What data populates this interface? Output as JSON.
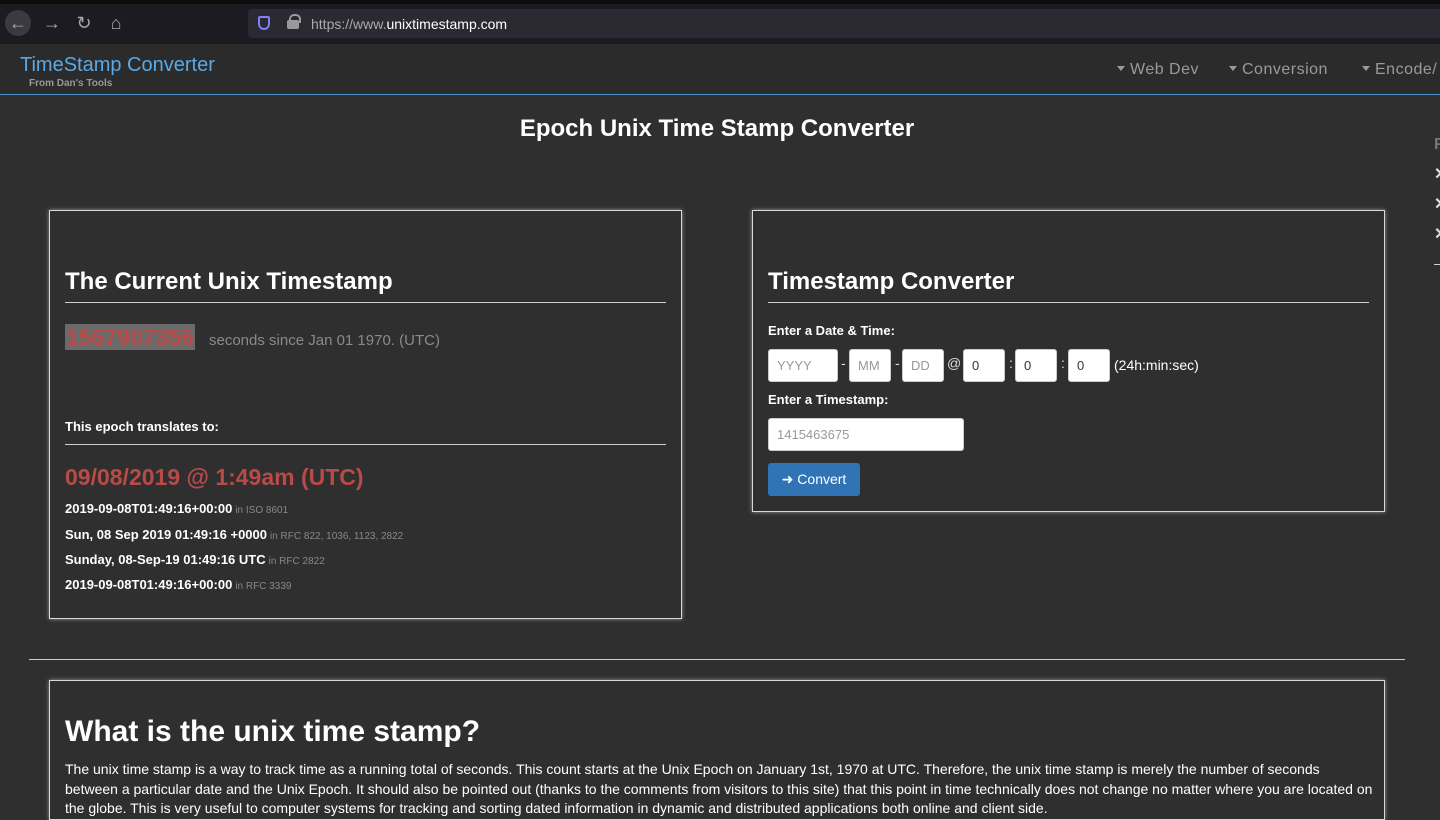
{
  "browser": {
    "url_prefix": "https://www.",
    "url_domain": "unixtimestamp",
    "url_suffix": ".com"
  },
  "header": {
    "brand": "TimeStamp Converter",
    "brand_sub": "From Dan's Tools",
    "nav": [
      "Web Dev",
      "Conversion",
      "Encode/"
    ]
  },
  "page_title": "Epoch Unix Time Stamp Converter",
  "current": {
    "heading": "The Current Unix Timestamp",
    "timestamp": "1567907356",
    "since_text": "seconds since Jan 01 1970. (UTC)",
    "translates_label": "This epoch translates to:",
    "date_display": "09/08/2019 @ 1:49am (UTC)",
    "formats": [
      {
        "value": "2019-09-08T01:49:16+00:00",
        "note": "in ISO 8601"
      },
      {
        "value": "Sun, 08 Sep 2019 01:49:16 +0000",
        "note": "in RFC 822, 1036, 1123, 2822"
      },
      {
        "value": "Sunday, 08-Sep-19 01:49:16 UTC",
        "note": "in RFC 2822"
      },
      {
        "value": "2019-09-08T01:49:16+00:00",
        "note": "in RFC 3339"
      }
    ]
  },
  "converter": {
    "heading": "Timestamp Converter",
    "date_label": "Enter a Date & Time:",
    "year_placeholder": "YYYY",
    "month_placeholder": "MM",
    "day_placeholder": "DD",
    "at": "@",
    "hour": "0",
    "min": "0",
    "sec": "0",
    "time_hint": "(24h:min:sec)",
    "dash": "-",
    "colon": ":",
    "ts_label": "Enter a Timestamp:",
    "ts_placeholder": "1415463675",
    "convert_label": "Convert"
  },
  "what": {
    "heading": "What is the unix time stamp?",
    "body": "The unix time stamp is a way to track time as a running total of seconds. This count starts at the Unix Epoch on January 1st, 1970 at UTC. Therefore, the unix time stamp is merely the number of seconds between a particular date and the Unix Epoch. It should also be pointed out (thanks to the comments from visitors to this site) that this point in time technically does not change no matter where you are located on the globe. This is very useful to computer systems for tracking and sorting dated information in dynamic and distributed applications both online and client side."
  },
  "colors": {
    "accent": "#5aa9e6",
    "highlight_red": "#b94a48",
    "button_blue": "#3074b6",
    "background": "#2f2f2f"
  }
}
